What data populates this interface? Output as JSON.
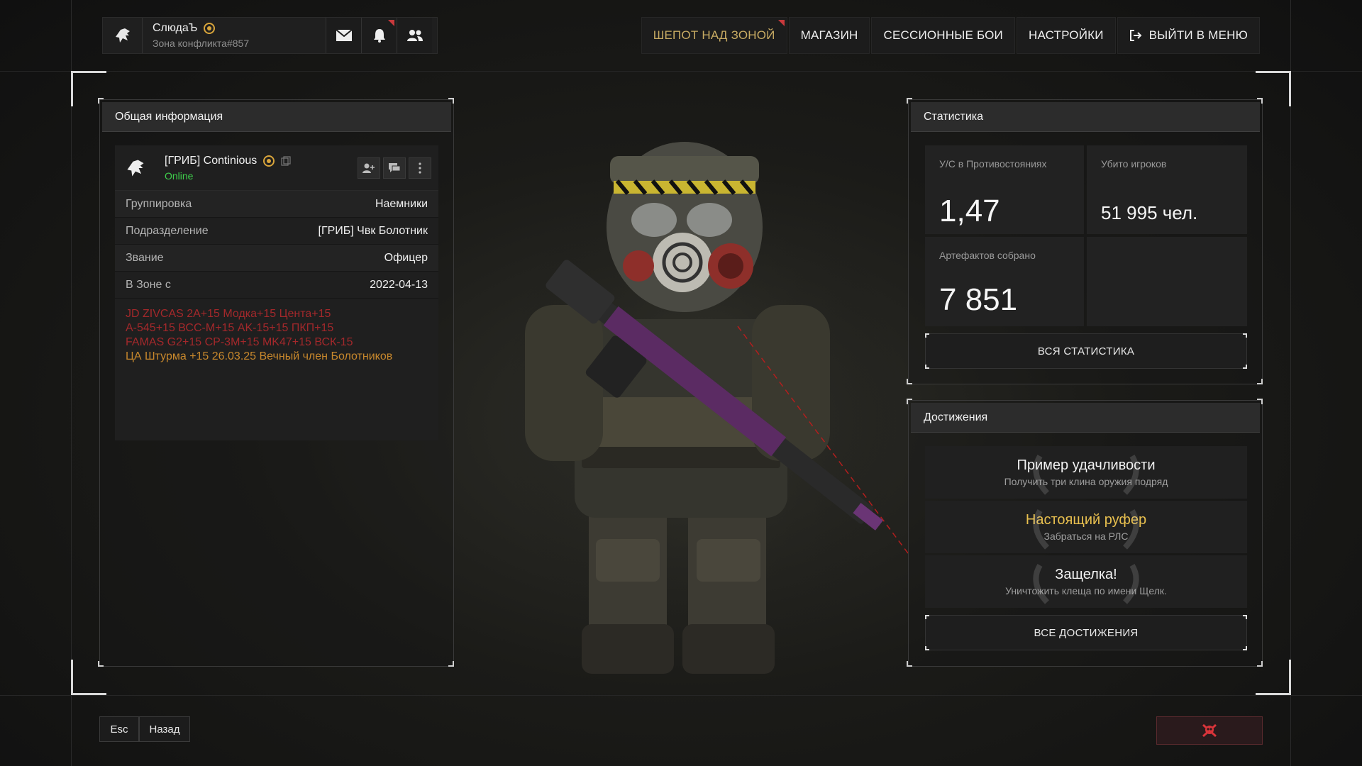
{
  "topbar": {
    "user_name": "СлюдаЪ",
    "user_sub": "Зона конфликта#857",
    "menu": [
      {
        "label": "ШЕПОТ НАД ЗОНОЙ",
        "active": true
      },
      {
        "label": "МАГАЗИН"
      },
      {
        "label": "СЕССИОННЫЕ БОИ"
      },
      {
        "label": "НАСТРОЙКИ"
      },
      {
        "label": "ВЫЙТИ В МЕНЮ"
      }
    ]
  },
  "general": {
    "header": "Общая информация",
    "player_name": "[ГРИБ] Continious",
    "status": "Online",
    "rows": [
      {
        "label": "Группировка",
        "value": "Наемники"
      },
      {
        "label": "Подразделение",
        "value": "[ГРИБ] Чвк Болотник"
      },
      {
        "label": "Звание",
        "value": "Офицер"
      },
      {
        "label": "В Зоне с",
        "value": "2022-04-13"
      }
    ],
    "bio_red": [
      "JD ZIVCAS 2A+15 Модка+15 Цента+15",
      "A-545+15 ВСС-М+15 AK-15+15 ПКП+15",
      "FAMAS G2+15 СР-3М+15 MK47+15 ВСК-15"
    ],
    "bio_orange": "ЦА Штурма +15 26.03.25  Вечный член Болотников"
  },
  "stats": {
    "header": "Статистика",
    "kd_label": "У/С в Противостояниях",
    "kd_value": "1,47",
    "kills_label": "Убито игроков",
    "kills_value": "51 995 чел.",
    "artifacts_label": "Артефактов собрано",
    "artifacts_value": "7 851",
    "all_button": "ВСЯ СТАТИСТИКА"
  },
  "achievements": {
    "header": "Достижения",
    "items": [
      {
        "title": "Пример удачливости",
        "desc": "Получить три клина оружия подряд",
        "gold": false
      },
      {
        "title": "Настоящий руфер",
        "desc": "Забраться на РЛС",
        "gold": true
      },
      {
        "title": "Защелка!",
        "desc": "Уничтожить клеща по имени Щелк.",
        "gold": false
      }
    ],
    "all_button": "ВСЕ ДОСТИЖЕНИЯ"
  },
  "bottom": {
    "esc_label": "Esc",
    "back_label": "Назад"
  },
  "colors": {
    "accent_gold": "#c8ab63",
    "online_green": "#3fcf4c",
    "bio_red": "#a3282b",
    "bio_orange": "#c8882c",
    "notify_red": "#c9393c"
  }
}
